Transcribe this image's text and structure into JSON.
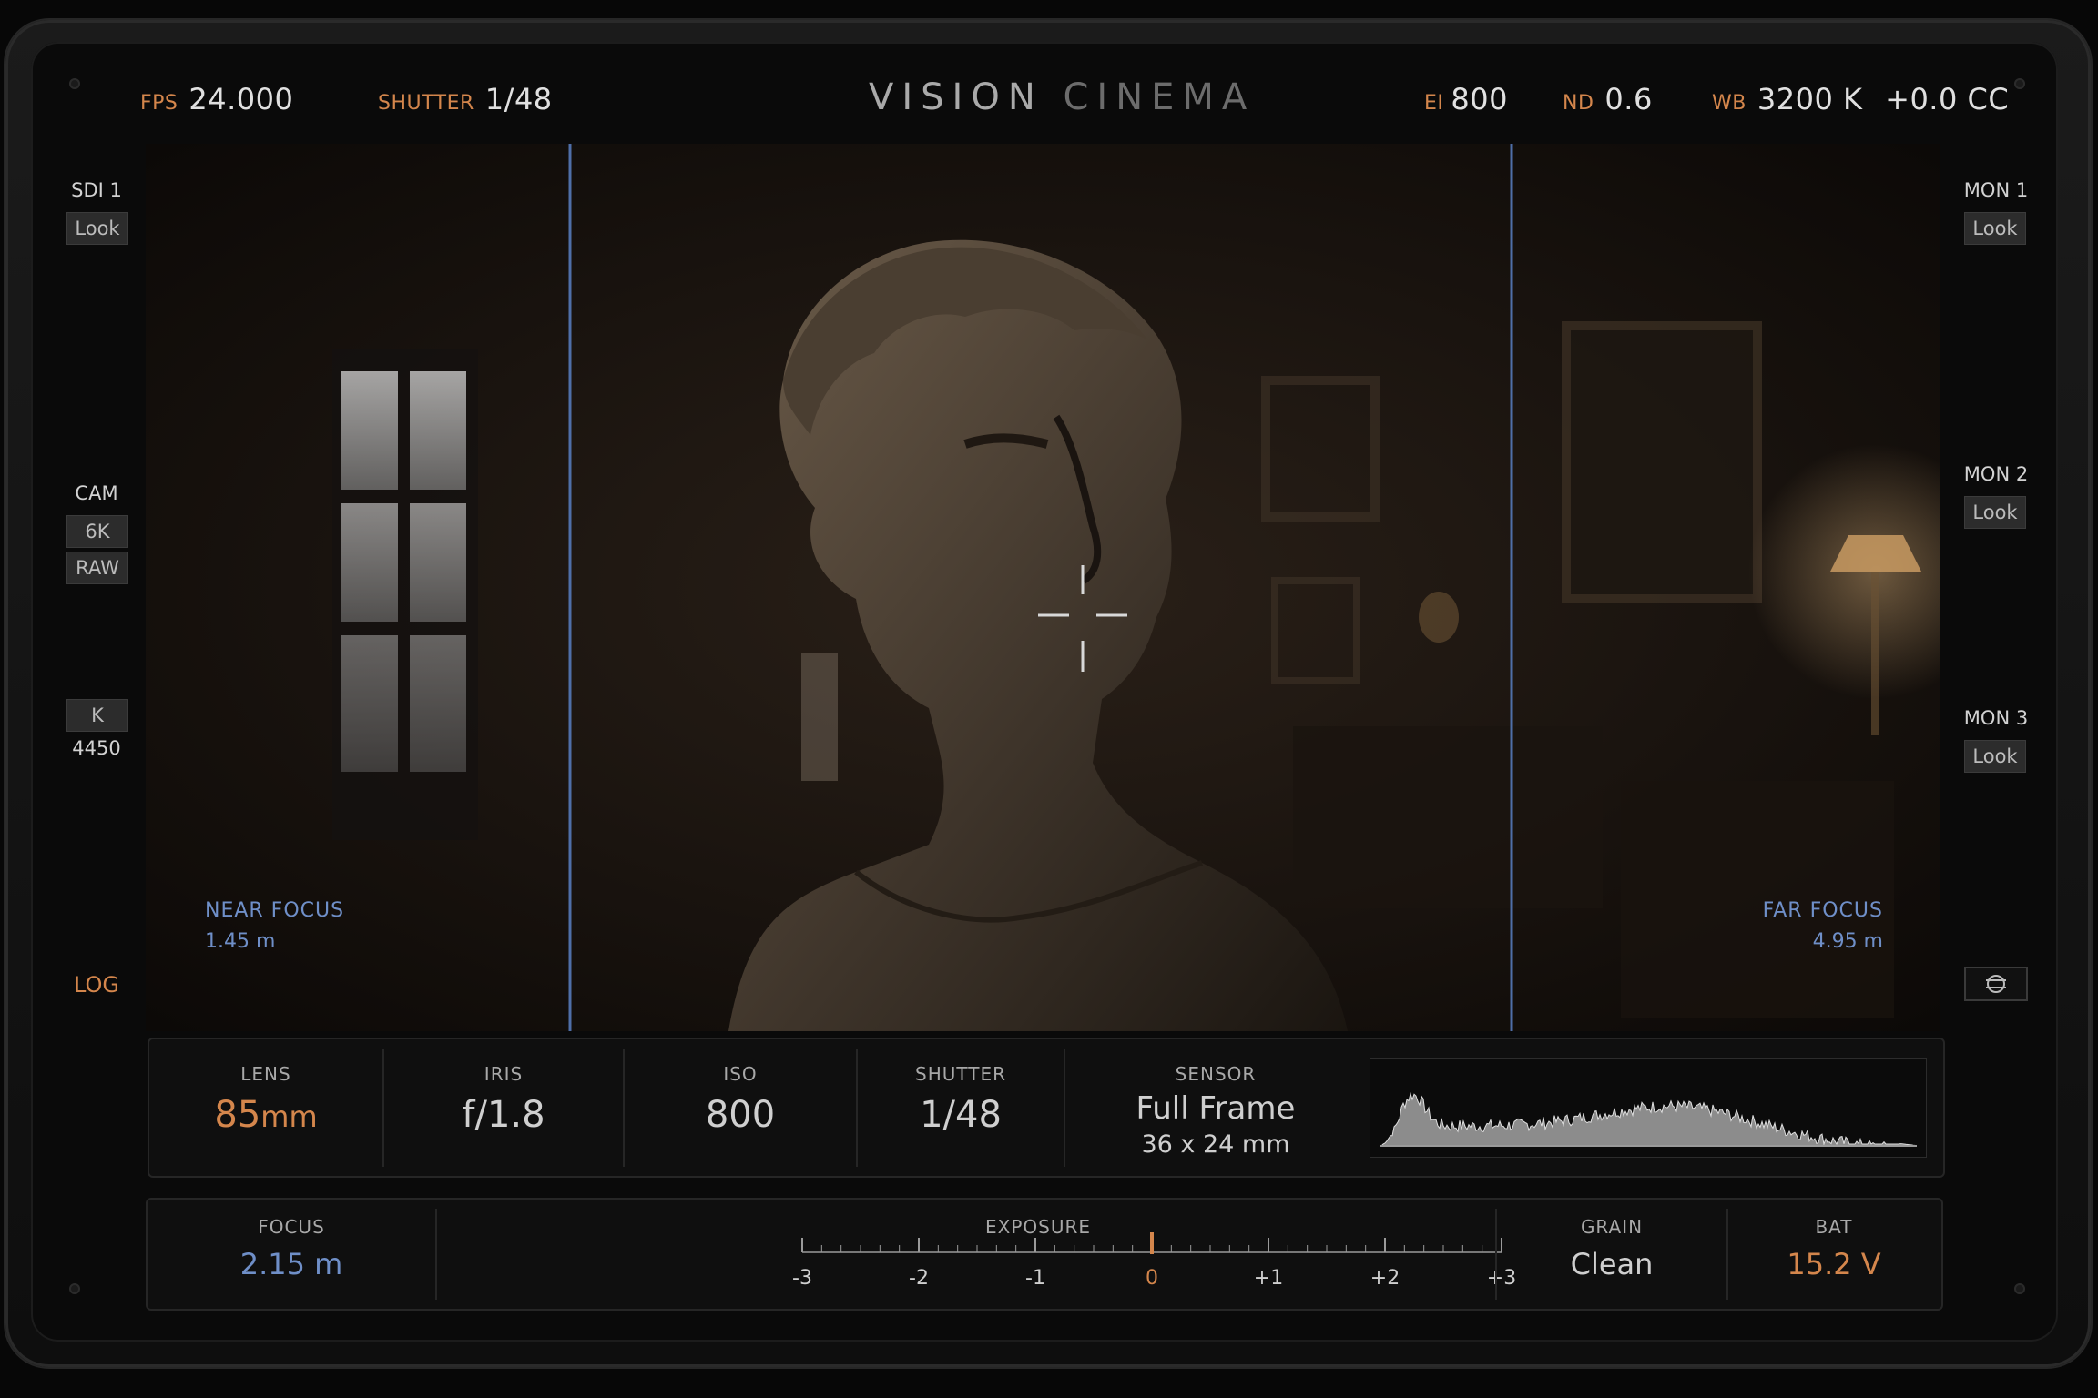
{
  "header": {
    "fps_label": "FPS",
    "fps_value": "24.000",
    "shutter_label": "SHUTTER",
    "shutter_value": "1/48",
    "brand_primary": "VISION",
    "brand_secondary": "CINEMA",
    "ei_label": "EI",
    "ei_value": "800",
    "nd_label": "ND",
    "nd_value": "0.6",
    "wb_label": "WB",
    "wb_value": "3200 K",
    "cc_value": "+0.0 CC"
  },
  "left_rail": {
    "sdi_label": "SDI 1",
    "sdi_button": "Look",
    "cam_label": "CAM",
    "res_button": "6K",
    "format_button": "RAW",
    "k_button": "K",
    "k_value": "4450",
    "log_label": "LOG"
  },
  "right_rail": {
    "mon1_label": "MON 1",
    "mon1_button": "Look",
    "mon2_label": "MON 2",
    "mon2_button": "Look",
    "mon3_label": "MON 3",
    "mon3_button": "Look",
    "settings_icon": "sliders-icon"
  },
  "viewport": {
    "near_focus_label": "NEAR FOCUS",
    "near_focus_value": "1.45 m",
    "far_focus_label": "FAR FOCUS",
    "far_focus_value": "4.95 m",
    "crosshair_icon": "crosshair-icon"
  },
  "info_panel": {
    "lens_label": "LENS",
    "lens_value": "85",
    "lens_unit": "mm",
    "iris_label": "IRIS",
    "iris_value": "f/1.8",
    "iso_label": "ISO",
    "iso_value": "800",
    "shutter_label": "SHUTTER",
    "shutter_value": "1/48",
    "sensor_label": "SENSOR",
    "sensor_value": "Full Frame",
    "sensor_size": "36 x 24 mm"
  },
  "bottom_panel": {
    "focus_label": "FOCUS",
    "focus_value": "2.15 m",
    "exposure_label": "EXPOSURE",
    "exposure_ticks": [
      "-3",
      "-2",
      "-1",
      "0",
      "+1",
      "+2",
      "+3"
    ],
    "exposure_value": 0,
    "grain_label": "GRAIN",
    "grain_value": "Clean",
    "bat_label": "BAT",
    "bat_value": "15.2 V"
  },
  "colors": {
    "accent_orange": "#d4864c",
    "accent_blue": "#6f8fc8",
    "focus_line": "#4f6fa8"
  }
}
